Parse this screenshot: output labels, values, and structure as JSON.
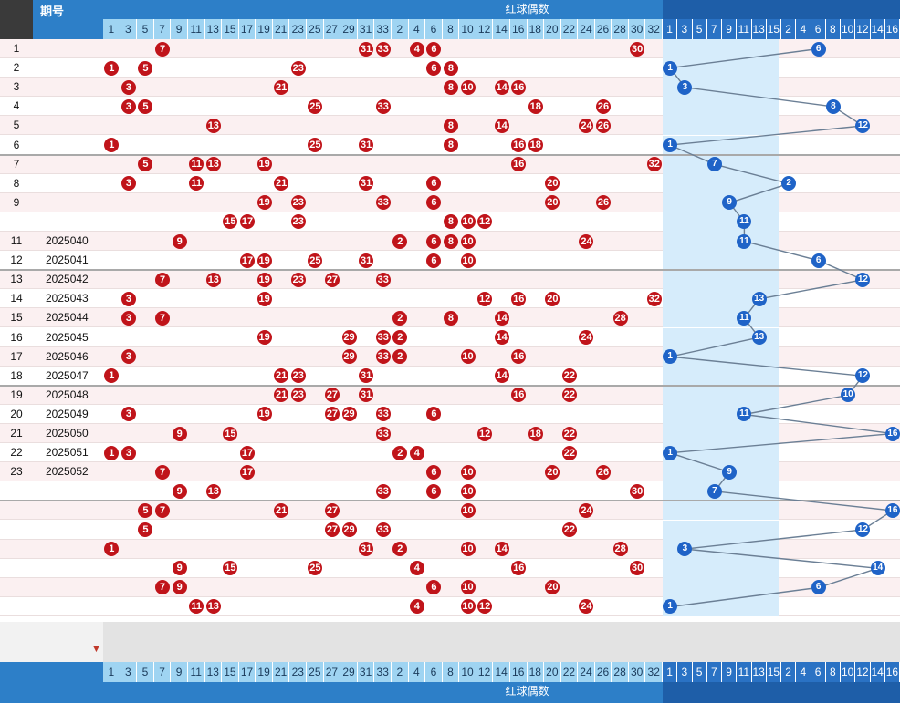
{
  "header": {
    "period_label": "期号",
    "red_parity_title": "红球偶数",
    "red_odd_numbers": [
      "1",
      "3",
      "5",
      "7",
      "9",
      "11",
      "13",
      "15",
      "17",
      "19",
      "21",
      "23",
      "25",
      "27",
      "29",
      "31",
      "33"
    ],
    "red_even_numbers": [
      "2",
      "4",
      "6",
      "8",
      "10",
      "12",
      "14",
      "16",
      "18",
      "20",
      "22",
      "24",
      "26",
      "28",
      "30",
      "32"
    ],
    "blue_odd_numbers": [
      "1",
      "3",
      "5",
      "7",
      "9",
      "11",
      "13",
      "15"
    ],
    "blue_even_numbers": [
      "2",
      "4",
      "6",
      "8",
      "10",
      "12",
      "14",
      "16"
    ]
  },
  "footer": {
    "red_parity_title": "红球偶数",
    "sort_icon": "arrow-down-icon"
  },
  "colors": {
    "header_blue": "#2d7fc8",
    "red_ball": "#c0141a",
    "blue_ball": "#1f63c7",
    "row_pink": "#fbeff0",
    "blue_zone": "#d6ecfb"
  },
  "rows": [
    {
      "idx": "1",
      "period": "",
      "red": [
        7,
        31,
        33,
        4,
        6,
        30
      ],
      "blue": 6
    },
    {
      "idx": "2",
      "period": "",
      "red": [
        1,
        5,
        23,
        6,
        8
      ],
      "blue": 1
    },
    {
      "idx": "3",
      "period": "",
      "red": [
        3,
        21,
        8,
        10,
        14,
        16
      ],
      "blue": 3
    },
    {
      "idx": "4",
      "period": "",
      "red": [
        3,
        5,
        25,
        33,
        18,
        26
      ],
      "blue": 8
    },
    {
      "idx": "5",
      "period": "",
      "red": [
        13,
        8,
        14,
        24,
        26
      ],
      "blue": 12
    },
    {
      "idx": "6",
      "period": "",
      "red": [
        1,
        25,
        31,
        8,
        16,
        18
      ],
      "blue": 1
    },
    {
      "idx": "7",
      "period": "",
      "red": [
        5,
        11,
        13,
        19,
        16,
        32
      ],
      "blue": 7
    },
    {
      "idx": "8",
      "period": "",
      "red": [
        3,
        11,
        21,
        31,
        6,
        20
      ],
      "blue": 2
    },
    {
      "idx": "9",
      "period": "",
      "red": [
        19,
        23,
        33,
        6,
        20,
        26
      ],
      "blue": 9
    },
    {
      "idx": "",
      "period": "",
      "red": [
        15,
        17,
        23,
        8,
        10,
        12
      ],
      "blue": 11
    },
    {
      "idx": "11",
      "period": "2025040",
      "red": [
        9,
        2,
        6,
        8,
        10,
        24
      ],
      "blue": 11
    },
    {
      "idx": "12",
      "period": "2025041",
      "red": [
        17,
        19,
        25,
        31,
        6,
        10
      ],
      "blue": 6
    },
    {
      "idx": "13",
      "period": "2025042",
      "red": [
        7,
        13,
        19,
        23,
        27,
        33
      ],
      "blue": 12
    },
    {
      "idx": "14",
      "period": "2025043",
      "red": [
        3,
        19,
        12,
        16,
        20,
        32
      ],
      "blue": 13
    },
    {
      "idx": "15",
      "period": "2025044",
      "red": [
        3,
        7,
        2,
        8,
        14,
        28
      ],
      "blue": 11
    },
    {
      "idx": "16",
      "period": "2025045",
      "red": [
        19,
        29,
        33,
        2,
        14,
        24
      ],
      "blue": 13
    },
    {
      "idx": "17",
      "period": "2025046",
      "red": [
        3,
        29,
        33,
        2,
        10,
        16
      ],
      "blue": 1
    },
    {
      "idx": "18",
      "period": "2025047",
      "red": [
        1,
        21,
        23,
        31,
        14,
        22
      ],
      "blue": 12
    },
    {
      "idx": "19",
      "period": "2025048",
      "red": [
        21,
        23,
        27,
        31,
        16,
        22
      ],
      "blue": 10
    },
    {
      "idx": "20",
      "period": "2025049",
      "red": [
        3,
        19,
        27,
        29,
        33,
        6
      ],
      "blue": 11
    },
    {
      "idx": "21",
      "period": "2025050",
      "red": [
        9,
        15,
        33,
        12,
        18,
        22
      ],
      "blue": 16
    },
    {
      "idx": "22",
      "period": "2025051",
      "red": [
        1,
        3,
        17,
        2,
        4,
        22
      ],
      "blue": 1
    },
    {
      "idx": "23",
      "period": "2025052",
      "red": [
        7,
        17,
        6,
        10,
        20,
        26
      ],
      "blue": 9
    },
    {
      "idx": "",
      "period": "",
      "red": [
        9,
        13,
        33,
        6,
        10,
        30
      ],
      "blue": 7
    },
    {
      "idx": "",
      "period": "",
      "red": [
        5,
        7,
        21,
        27,
        10,
        24
      ],
      "blue": 16
    },
    {
      "idx": "",
      "period": "",
      "red": [
        5,
        27,
        29,
        33,
        22
      ],
      "blue": 12
    },
    {
      "idx": "",
      "period": "",
      "red": [
        1,
        31,
        2,
        10,
        14,
        28
      ],
      "blue": 3
    },
    {
      "idx": "",
      "period": "",
      "red": [
        9,
        15,
        25,
        4,
        16,
        30
      ],
      "blue": 14
    },
    {
      "idx": "",
      "period": "",
      "red": [
        7,
        9,
        6,
        10,
        20
      ],
      "blue": 6
    },
    {
      "idx": "",
      "period": "",
      "red": [
        11,
        13,
        4,
        10,
        12,
        24
      ],
      "blue": 1
    }
  ]
}
